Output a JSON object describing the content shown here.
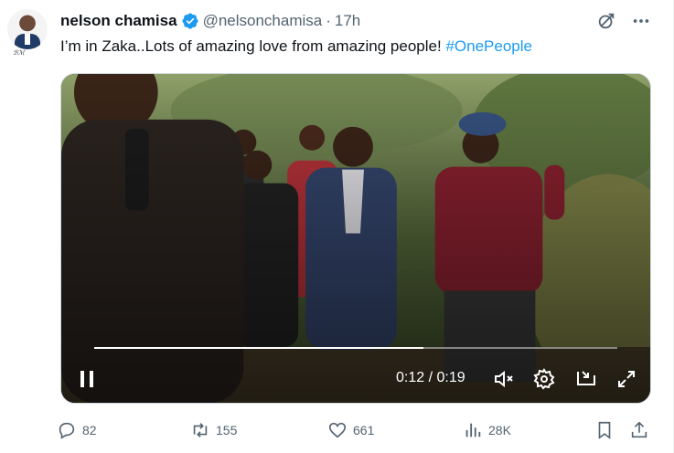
{
  "author": {
    "display_name": "nelson chamisa",
    "handle": "@nelsonchamisa",
    "separator": "·",
    "time": "17h",
    "verified": true,
    "verified_color": "#1d9bf0"
  },
  "tweet": {
    "text": "I’m in Zaka..Lots of amazing love from amazing people! ",
    "hashtag": "#OnePeople",
    "hashtag_color": "#1d9bf0"
  },
  "video": {
    "time_current": "0:12",
    "time_total": "0:19",
    "time_display": "0:12 / 0:19",
    "progress": 0.63,
    "state": "playing",
    "icons": [
      "pause-icon",
      "mute-icon",
      "settings-icon",
      "pip-icon",
      "fullscreen-icon"
    ]
  },
  "actions": {
    "replies": "82",
    "reposts": "155",
    "likes": "661",
    "views": "28K",
    "icons": [
      "reply-icon",
      "repost-icon",
      "like-icon",
      "views-icon",
      "bookmark-icon",
      "share-icon"
    ]
  },
  "header_icons": [
    "grok-icon",
    "more-icon"
  ],
  "colors": {
    "text_primary": "#0f1419",
    "text_secondary": "#536471",
    "accent": "#1d9bf0"
  }
}
